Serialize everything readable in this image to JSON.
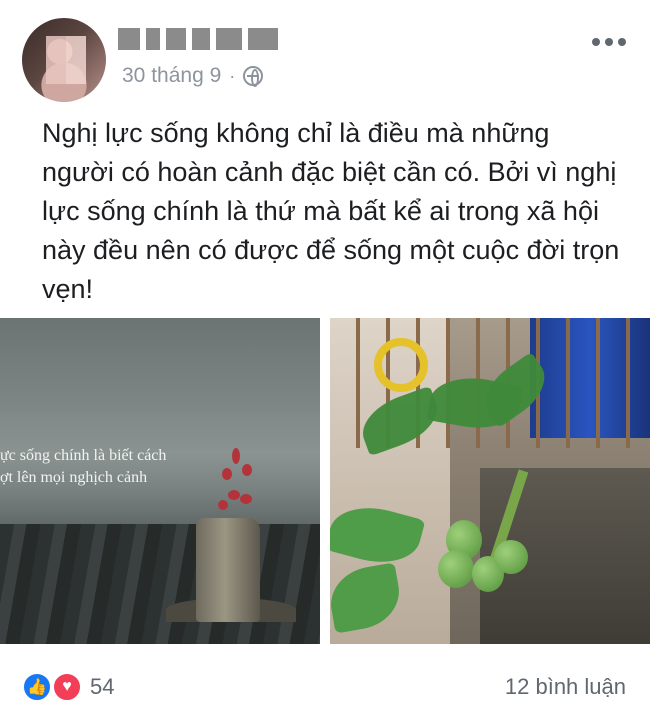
{
  "post": {
    "author_blurred": true,
    "date": "30 tháng 9",
    "separator": "·",
    "privacy_icon": "globe-icon",
    "text": "Nghị lực sống không chỉ là điều mà những người có hoàn cảnh đặc biệt cần có. Bởi vì nghị lực sống chính là thứ mà bất kể ai trong xã hội này đều nên có được để sống một cuộc đời trọn vẹn!"
  },
  "images": {
    "left_caption": "ực sống chính là biết cách\nợt lên mọi nghịch cảnh"
  },
  "footer": {
    "reaction_count": "54",
    "comment_count": "12 bình luận",
    "reactions": [
      "like-icon",
      "love-icon"
    ]
  },
  "colors": {
    "meta": "#8d949e",
    "like": "#1877f2",
    "love": "#f33e58"
  }
}
